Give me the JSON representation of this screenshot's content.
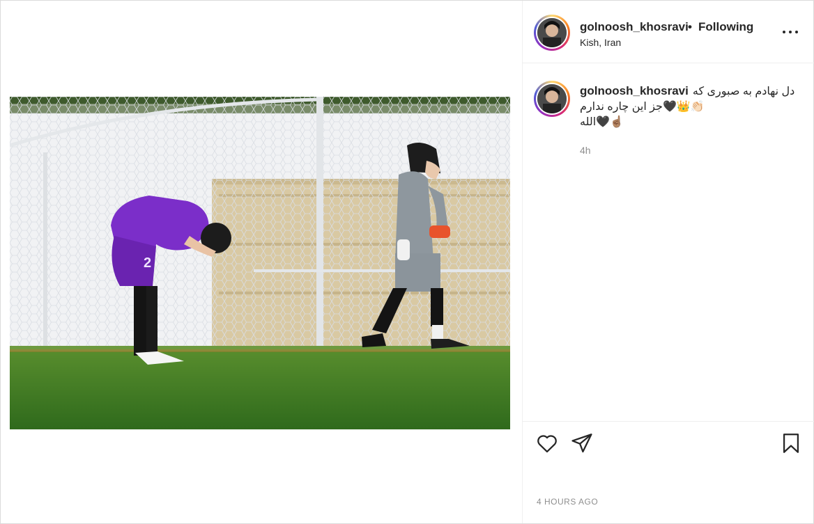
{
  "post": {
    "username": "golnoosh_khosravi",
    "separator": "•",
    "follow_label": "Following",
    "location": "Kish, Iran",
    "caption_line1": "دل نهادم به صبوری که",
    "caption_line2": "👏🏻👑🖤جز این چاره ندارم",
    "caption_line3": "☝🏽🖤الله",
    "caption_age": "4h",
    "timestamp": "4 HOURS AGO"
  },
  "icons": {
    "more": "more-options-icon",
    "like": "heart-icon",
    "share": "paper-plane-icon",
    "save": "bookmark-icon"
  },
  "colors": {
    "text": "#262626",
    "muted": "#8e8e8e",
    "border": "#dbdbdb",
    "jersey": "#7b2ec9",
    "pitch": "#3f7a24"
  }
}
